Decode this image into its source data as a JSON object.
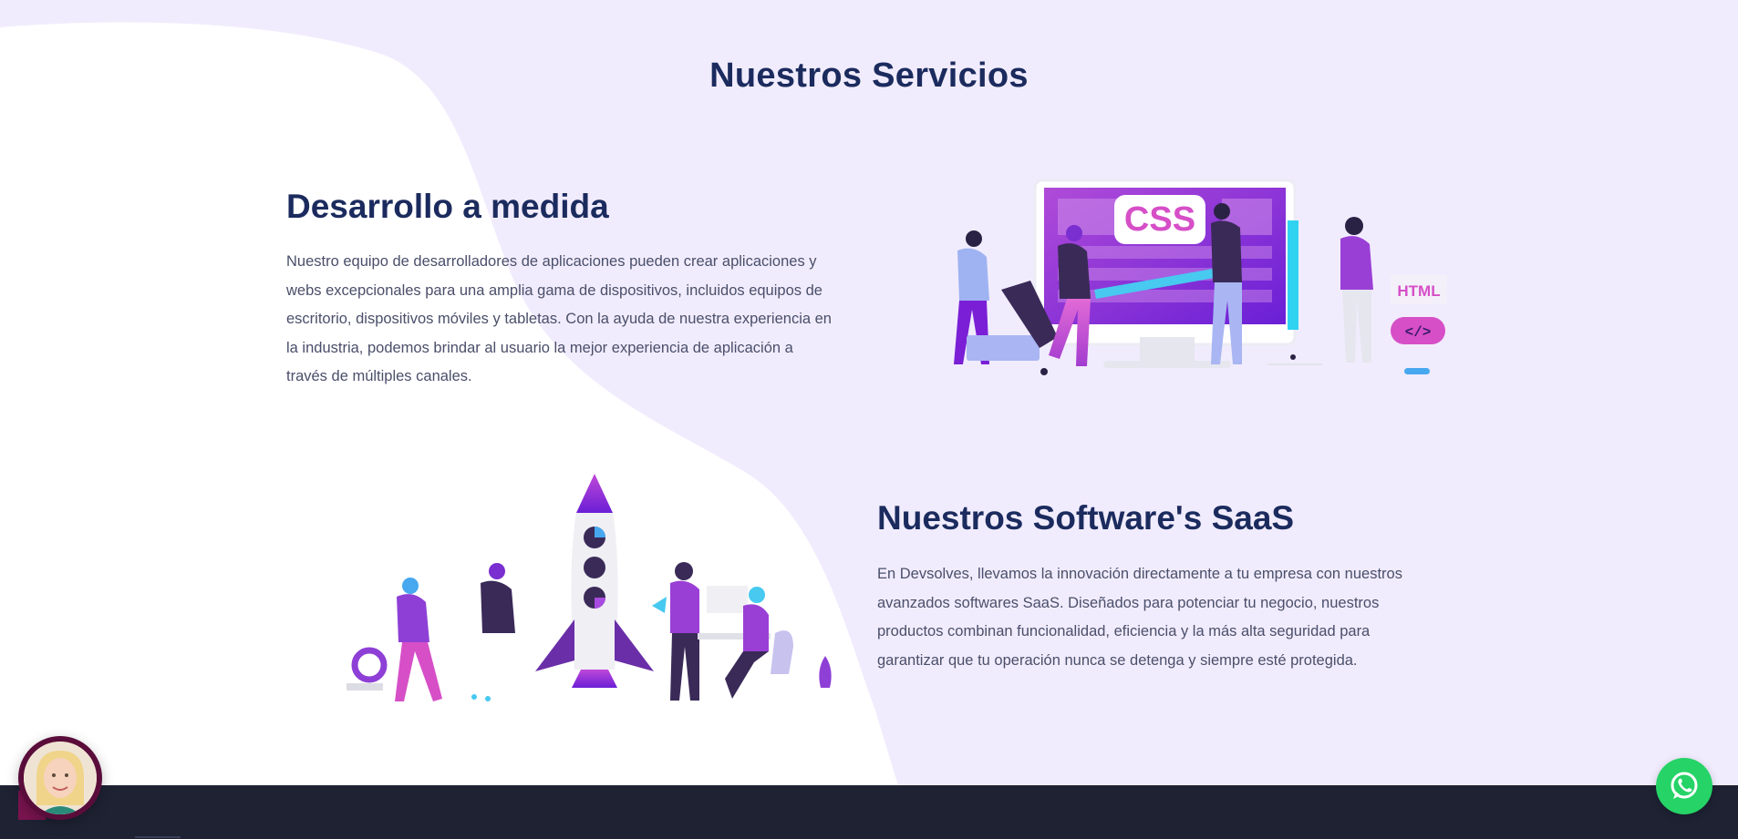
{
  "page": {
    "section_title": "Nuestros Servicios"
  },
  "services": [
    {
      "title": "Desarrollo a medida",
      "text": "Nuestro equipo de desarrolladores de aplicaciones pueden crear aplicaciones y webs excepcionales para una amplia gama de dispositivos, incluidos equipos de escritorio, dispositivos móviles y tabletas. Con la ayuda de nuestra experiencia en la industria, podemos brindar al usuario la mejor experiencia de aplicación a través de múltiples canales.",
      "illustration": {
        "css_label": "CSS",
        "html_label": "HTML",
        "code_label": "</>"
      }
    },
    {
      "title": "Nuestros Software's SaaS",
      "text": "En Devsolves, llevamos la innovación directamente a tu empresa con nuestros avanzados softwares SaaS. Diseñados para potenciar tu negocio, nuestros productos combinan funcionalidad, eficiencia y la más alta seguridad para garantizar que tu operación nunca se detenga y siempre esté protegida."
    }
  ],
  "colors": {
    "background": "#f1ecfd",
    "heading": "#1b2b5e",
    "body_text": "#4a4f6a",
    "accent_purple": "#8e2de2",
    "accent_pink": "#d64fc7",
    "footer": "#1e2233",
    "whatsapp": "#25d366"
  },
  "floating": {
    "avatar_icon": "avatar-icon",
    "whatsapp_icon": "whatsapp-icon"
  }
}
